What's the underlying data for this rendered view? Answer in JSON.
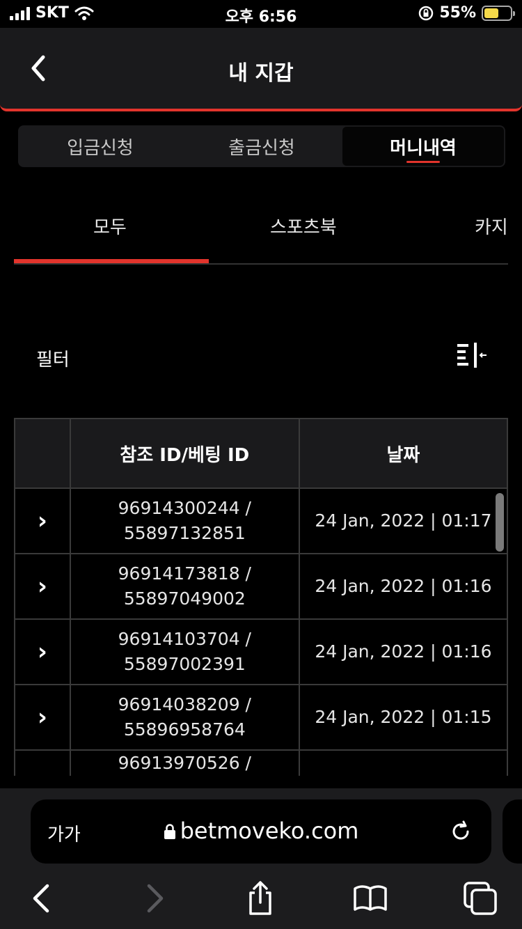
{
  "status_bar": {
    "carrier": "SKT",
    "time": "오후 6:56",
    "battery": "55%"
  },
  "header": {
    "title": "내 지갑"
  },
  "segmented_tabs": [
    {
      "label": "입금신청",
      "active": false
    },
    {
      "label": "출금신청",
      "active": false
    },
    {
      "label": "머니내역",
      "active": true
    }
  ],
  "sub_tabs": [
    {
      "label": "모두",
      "active": true
    },
    {
      "label": "스포츠북",
      "active": false
    },
    {
      "label": "카지"
    }
  ],
  "filter": {
    "label": "필터"
  },
  "table": {
    "columns": [
      "",
      "참조 ID/베팅 ID",
      "날짜"
    ],
    "rows": [
      {
        "ref_id": "96914300244 /",
        "bet_id": "55897132851",
        "date": "24 Jan, 2022 | 01:17"
      },
      {
        "ref_id": "96914173818 /",
        "bet_id": "55897049002",
        "date": "24 Jan, 2022 | 01:16"
      },
      {
        "ref_id": "96914103704 /",
        "bet_id": "55897002391",
        "date": "24 Jan, 2022 | 01:16"
      },
      {
        "ref_id": "96914038209 /",
        "bet_id": "55896958764",
        "date": "24 Jan, 2022 | 01:15"
      },
      {
        "ref_id": "96913970526 /",
        "bet_id": "",
        "date": ""
      }
    ]
  },
  "browser": {
    "text_size_label": "가가",
    "url": "betmoveko.com"
  },
  "colors": {
    "accent": "#e2342c",
    "background": "#000000",
    "surface": "#1a1a1c"
  }
}
